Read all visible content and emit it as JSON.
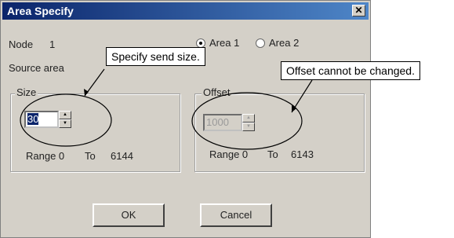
{
  "dialog": {
    "title": "Area Specify",
    "close_label": "✕",
    "node_label": "Node",
    "node_value": "1",
    "area1_label": "Area 1",
    "area2_label": "Area 2",
    "source_area_label": "Source area",
    "size_group_title": "Size",
    "size_value": "30",
    "size_range_from_label": "Range 0",
    "size_range_to_label": "To",
    "size_range_max": "6144",
    "offset_group_title": "Offset",
    "offset_value": "1000",
    "offset_range_from_label": "Range 0",
    "offset_range_to_label": "To",
    "offset_range_max": "6143",
    "ok_label": "OK",
    "cancel_label": "Cancel",
    "selected_area": "Area 1"
  },
  "callouts": {
    "size_note": "Specify send size.",
    "offset_note": "Offset cannot be changed."
  }
}
